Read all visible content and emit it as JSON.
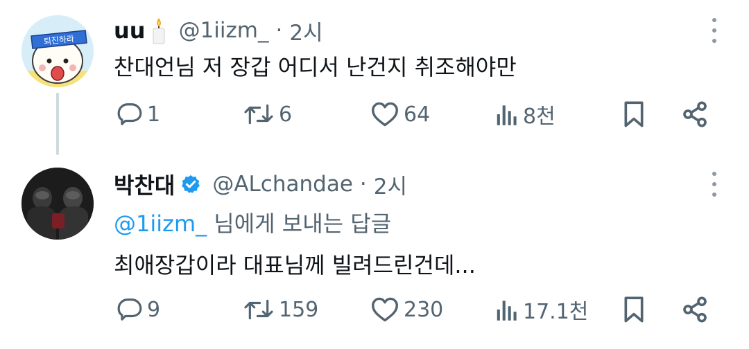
{
  "tweets": [
    {
      "name": "uu",
      "handle": "@1iizm_",
      "dot": "·",
      "time": "2시",
      "avatar_text": "퇴진하라",
      "text": "찬대언님 저 장갑 어디서 난건지 취조해야만",
      "stats": {
        "replies": "1",
        "retweets": "6",
        "likes": "64",
        "views": "8천"
      },
      "icons": [
        "candle-icon",
        "reply-icon",
        "retweet-icon",
        "heart-icon",
        "views-icon",
        "bookmark-icon",
        "share-icon",
        "more-icon"
      ]
    },
    {
      "name": "박찬대",
      "handle": "@ALchandae",
      "dot": "·",
      "time": "2시",
      "reply_mention": "@1iizm_",
      "reply_suffix": " 님에게 보내는 답글",
      "text": "최애장갑이라 대표님께 빌려드린건데...",
      "stats": {
        "replies": "9",
        "retweets": "159",
        "likes": "230",
        "views": "17.1천"
      },
      "icons": [
        "verified-badge-icon",
        "reply-icon",
        "retweet-icon",
        "heart-icon",
        "views-icon",
        "bookmark-icon",
        "share-icon",
        "more-icon"
      ]
    }
  ],
  "colors": {
    "text": "#0f1419",
    "secondary": "#536471",
    "link": "#1d9bf0",
    "verified": "#1d9bf0",
    "line": "#cfd9de"
  }
}
